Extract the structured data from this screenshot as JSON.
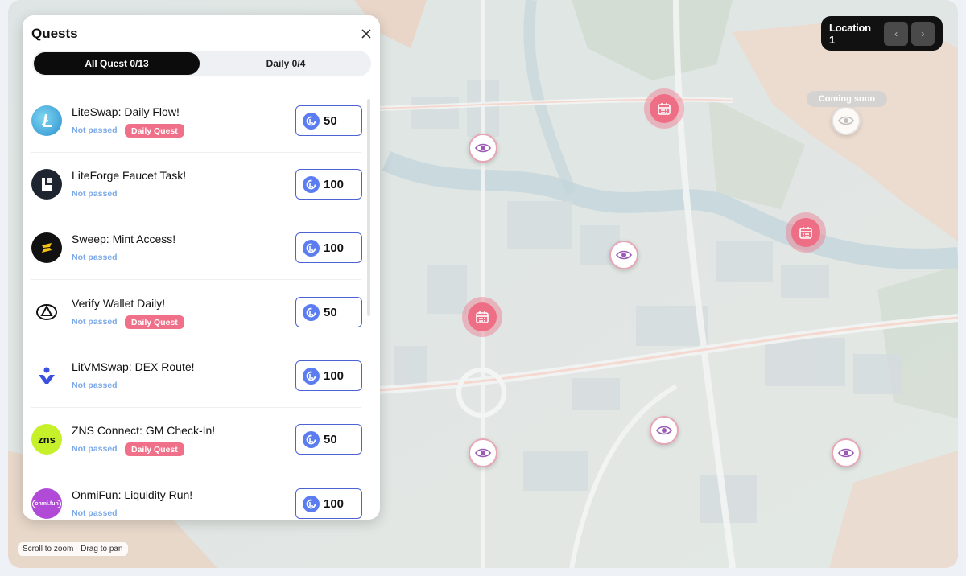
{
  "panel": {
    "title": "Quests",
    "tabs": [
      {
        "label": "All Quest 0/13",
        "active": true
      },
      {
        "label": "Daily 0/4",
        "active": false
      }
    ],
    "quests": [
      {
        "title": "LiteSwap: Daily Flow!",
        "status": "Not passed",
        "tag": "Daily Quest",
        "reward": "50",
        "logo": "liteswap-logo"
      },
      {
        "title": "LiteForge Faucet Task!",
        "status": "Not passed",
        "tag": "",
        "reward": "100",
        "logo": "liteforge-logo"
      },
      {
        "title": "Sweep: Mint Access!",
        "status": "Not passed",
        "tag": "",
        "reward": "100",
        "logo": "sweep-logo"
      },
      {
        "title": "Verify Wallet Daily!",
        "status": "Not passed",
        "tag": "Daily Quest",
        "reward": "50",
        "logo": "verify-wallet-logo"
      },
      {
        "title": "LitVMSwap: DEX Route!",
        "status": "Not passed",
        "tag": "",
        "reward": "100",
        "logo": "litvmswap-logo"
      },
      {
        "title": "ZNS Connect: GM Check-In!",
        "status": "Not passed",
        "tag": "Daily Quest",
        "reward": "50",
        "logo": "zns-logo"
      },
      {
        "title": "OnmiFun: Liquidity Run!",
        "status": "Not passed",
        "tag": "",
        "reward": "100",
        "logo": "onmifun-logo"
      }
    ],
    "logo_text": {
      "zns": "zns",
      "onmifun": "onmi.fun"
    }
  },
  "location": {
    "label": "Location 1",
    "prev_icon": "chevron-left-icon",
    "next_icon": "chevron-right-icon"
  },
  "map": {
    "coming_soon": "Coming soon",
    "hint": "Scroll to zoom · Drag to pan"
  },
  "colors": {
    "accent_blue": "#4b63d6",
    "tag_pink": "#ef7088",
    "status_blue": "#7aa8e6",
    "marker_pink": "#ee6e86"
  }
}
